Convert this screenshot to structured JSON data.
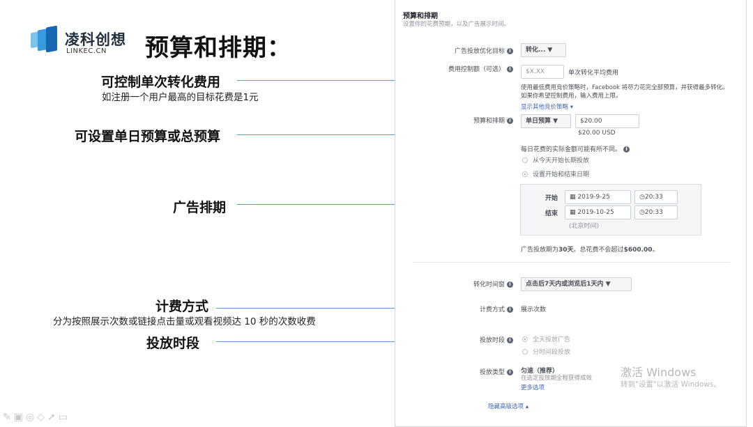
{
  "brand": {
    "name_cn": "凌科创想",
    "name_en": "LINKEC.CN"
  },
  "title": "预算和排期：",
  "annotations": [
    {
      "title": "可控制单次转化费用",
      "subtitle": "如注册一个用户最高的目标花费是1元"
    },
    {
      "title": "可设置单日预算或总预算"
    },
    {
      "title": "广告排期"
    },
    {
      "title": "计费方式",
      "subtitle": "分为按照展示次数或链接点击量或观看视频达 10 秒的次数收费"
    },
    {
      "title": "投放时段"
    }
  ],
  "panel": {
    "section_title": "预算和排期",
    "section_subtitle": "设置你的花费预期，以及广告展示时间。",
    "optimization": {
      "label": "广告投放优化目标",
      "value": "转化..."
    },
    "cost_control": {
      "label": "费用控制额（可选）",
      "placeholder": "$X.XX",
      "unit": "单次转化平均费用",
      "help": "使用最低费用竞价策略时，Facebook 将尽力花完全部预算，并获得最多转化。如果你希望控制费用，输入费用上限。",
      "link": "显示其他竞价策略 ▾"
    },
    "budget": {
      "label": "预算和排期",
      "type": "单日预算",
      "amount": "$20.00",
      "amount_note": "$20.00 USD",
      "note": "每日花费的实际金额可能有所不同。",
      "option_start_now": "从今天开始长期投放",
      "option_set_dates": "设置开始和结束日期",
      "start_label": "开始",
      "start_date": "2019-9-25",
      "start_time": "20:33",
      "end_label": "结束",
      "end_date": "2019-10-25",
      "end_time": "20:33",
      "timezone": "(北京时间)",
      "summary_prefix": "广告投放期为",
      "summary_days": "30天",
      "summary_mid": "。总花费不会超过",
      "summary_amount": "$600.00",
      "summary_end": "。"
    },
    "conversion_window": {
      "label": "转化时间窗",
      "value": "点击后7天内或浏览后1天内"
    },
    "billing": {
      "label": "计费方式",
      "value": "展示次数"
    },
    "schedule": {
      "label": "投放时段",
      "option_all_day": "全天投放广告",
      "option_scheduled": "分时间段投放"
    },
    "delivery_type": {
      "label": "投放类型",
      "value": "匀速（推荐）",
      "desc": "在选定投放期全程获得成效",
      "more_options": "更多选项"
    },
    "hide_advanced": "隐藏高级选项 ▴"
  },
  "watermark": {
    "line1": "激活 Windows",
    "line2": "转到\"设置\"以激活 Windows。"
  },
  "colors": {
    "arrow": "#5b9bd5",
    "link": "#4267b2",
    "logo_blue": "#1877c9"
  }
}
